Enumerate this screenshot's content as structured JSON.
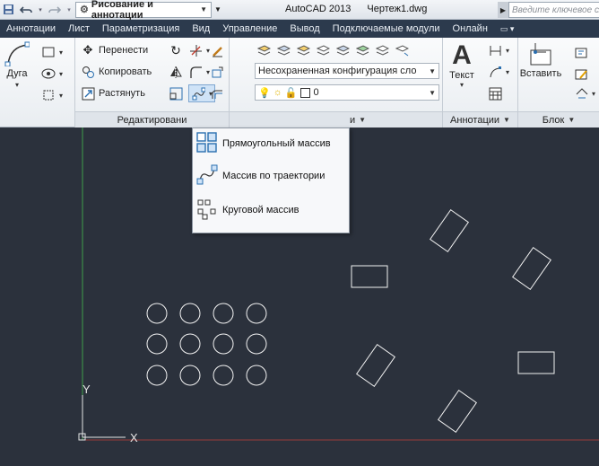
{
  "titlebar": {
    "workspace": "Рисование и аннотации",
    "app": "AutoCAD 2013",
    "document": "Чертеж1.dwg",
    "search_placeholder": "Введите ключевое сл"
  },
  "tabs": [
    {
      "label": "Аннотации"
    },
    {
      "label": "Лист"
    },
    {
      "label": "Параметризация"
    },
    {
      "label": "Вид"
    },
    {
      "label": "Управление"
    },
    {
      "label": "Вывод"
    },
    {
      "label": "Подключаемые модули"
    },
    {
      "label": "Онлайн"
    }
  ],
  "ribbon": {
    "draw": {
      "arc_label": "Дуга"
    },
    "modify": {
      "move_label": "Перенести",
      "copy_label": "Копировать",
      "stretch_label": "Растянуть",
      "title": "Редактировани"
    },
    "layers": {
      "config_value": "Несохраненная конфигурация сло",
      "layer_value": "0",
      "title": "и"
    },
    "annotation": {
      "text_label": "Текст",
      "title": "Аннотации"
    },
    "block": {
      "insert_label": "Вставить",
      "title": "Блок"
    }
  },
  "array_menu": {
    "items": [
      {
        "label": "Прямоугольный массив",
        "icon": "rect-array-icon"
      },
      {
        "label": "Массив по траектории",
        "icon": "path-array-icon"
      },
      {
        "label": "Круговой массив",
        "icon": "polar-array-icon"
      }
    ]
  },
  "canvas": {
    "ucs_y": "Y",
    "ucs_x": "X",
    "background": "#2b313c",
    "stroke": "#ffffff"
  }
}
